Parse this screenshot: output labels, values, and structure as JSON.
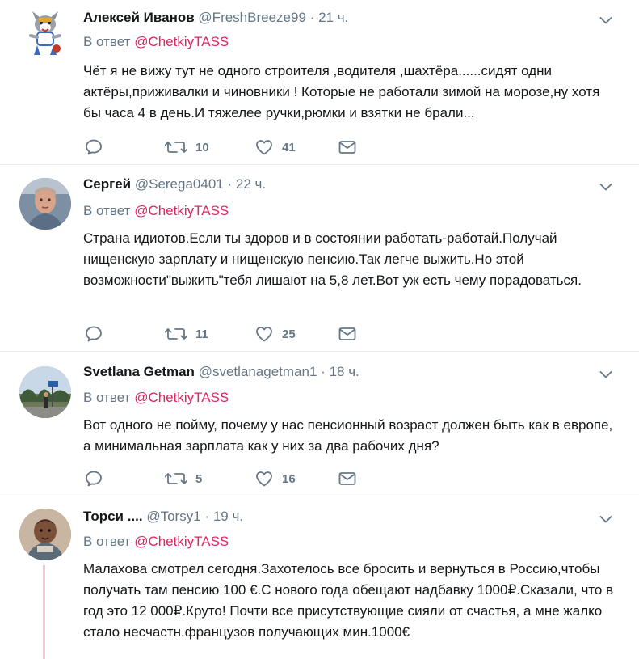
{
  "tweets": [
    {
      "name": "Алексей Иванов",
      "handle": "@FreshBreeze99",
      "dot": "·",
      "time": "21 ч.",
      "reply_prefix": "В ответ",
      "reply_to": "@ChetkiyTASS",
      "text": "Чёт я не вижу тут не одного строителя ,водителя ,шахтёра......сидят одни актёры,приживалки и  чиновники ! Которые не работали зимой на морозе,ну хотя бы часа 4 в день.И тяжелее ручки,рюмки и взятки не брали...",
      "retweets": "10",
      "likes": "41"
    },
    {
      "name": "Сергей",
      "handle": "@Serega0401",
      "dot": "·",
      "time": "22 ч.",
      "reply_prefix": "В ответ",
      "reply_to": "@ChetkiyTASS",
      "text": "Страна идиотов.Если ты здоров и в состоянии работать-работай.Получай нищенскую зарплату и нищенскую пенсию.Так легче выжить.Но этой возможности\"выжить\"тебя лишают на 5,8 лет.Вот уж есть чему порадоваться.",
      "retweets": "11",
      "likes": "25"
    },
    {
      "name": "Svetlana Getman",
      "handle": "@svetlanagetman1",
      "dot": "·",
      "time": "18 ч.",
      "reply_prefix": "В ответ",
      "reply_to": "@ChetkiyTASS",
      "text": "Вот одного не пойму, почему у нас пенсионный возраст должен быть как в европе, а минимальная зарплата как у них за два рабочих дня?",
      "retweets": "5",
      "likes": "16"
    },
    {
      "name": "Торси ....",
      "handle": "@Torsy1",
      "dot": "·",
      "time": "19 ч.",
      "reply_prefix": "В ответ",
      "reply_to": "@ChetkiyTASS",
      "text": "Малахова смотрел сегодня.Захотелось все бросить и вернуться в Россию,чтобы получать там пенсию 100 €.С нового года обещают надбавку 1000₽.Сказали, что в год это 12 000₽.Круто! Почти все присутствующие сияли от счастья, а мне жалко стало несчастн.французов получающих мин.1000€"
    }
  ],
  "icons": {
    "reply": "reply-icon",
    "retweet": "retweet-icon",
    "like": "heart-icon",
    "dm": "envelope-icon",
    "menu": "chevron-down-icon"
  },
  "colors": {
    "mention": "#e0245e",
    "muted": "#657786",
    "separator": "#e6ecf0",
    "thread_line": "#f7c7d4"
  }
}
